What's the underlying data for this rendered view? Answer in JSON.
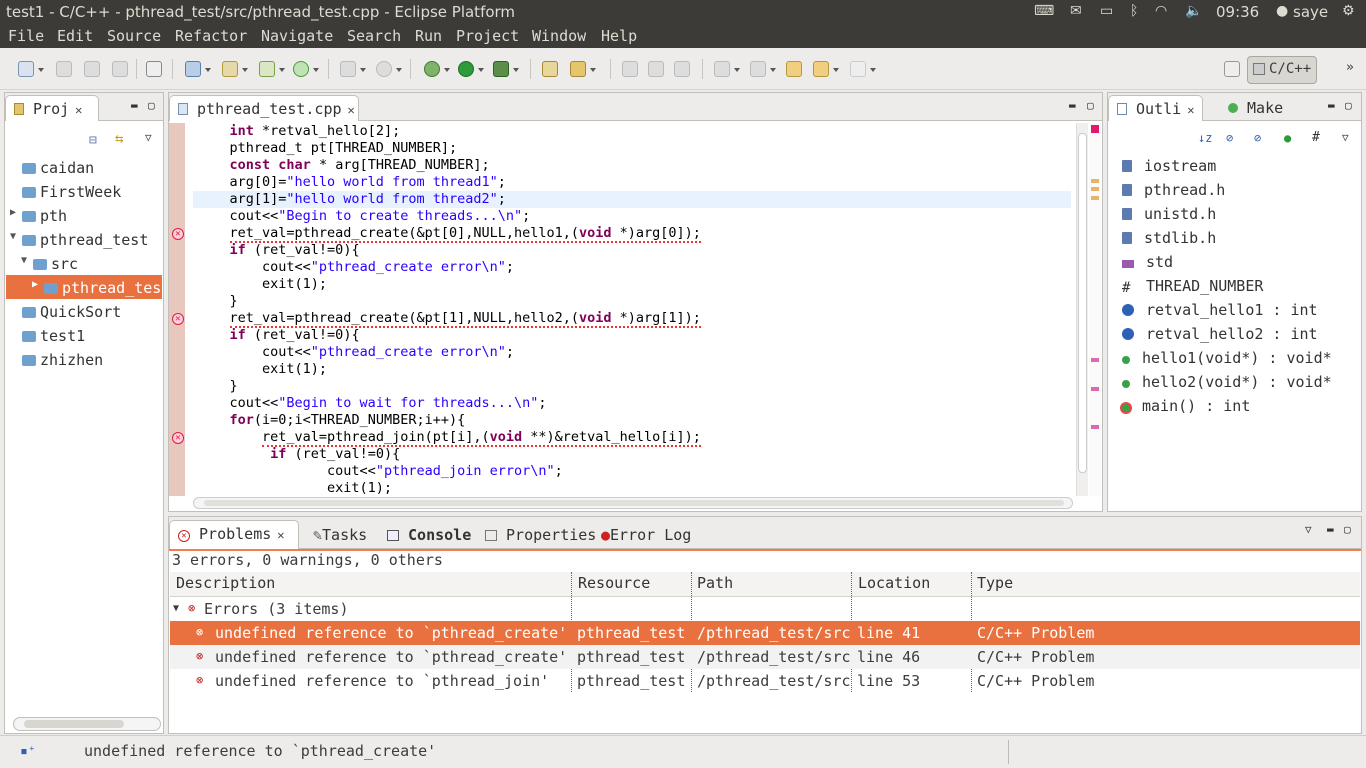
{
  "topbar": {
    "title": "test1 - C/C++ - pthread_test/src/pthread_test.cpp - Eclipse Platform",
    "time": "09:36",
    "user": "saye"
  },
  "menu": [
    "File",
    "Edit",
    "Source",
    "Refactor",
    "Navigate",
    "Search",
    "Run",
    "Project",
    "Window",
    "Help"
  ],
  "perspective": "C/C++",
  "project_explorer": {
    "tab": "Proj",
    "items": [
      {
        "label": "caidan",
        "indent": 0,
        "arrow": ""
      },
      {
        "label": "FirstWeek",
        "indent": 0,
        "arrow": ""
      },
      {
        "label": "pth",
        "indent": 0,
        "arrow": "▶"
      },
      {
        "label": "pthread_test",
        "indent": 0,
        "arrow": "▼"
      },
      {
        "label": "src",
        "indent": 1,
        "arrow": "▼"
      },
      {
        "label": "pthread_tes",
        "indent": 2,
        "arrow": "▶",
        "selected": true
      },
      {
        "label": "QuickSort",
        "indent": 0,
        "arrow": ""
      },
      {
        "label": "test1",
        "indent": 0,
        "arrow": ""
      },
      {
        "label": "zhizhen",
        "indent": 0,
        "arrow": ""
      }
    ]
  },
  "editor": {
    "tab": "pthread_test.cpp",
    "lines": [
      "    int *retval_hello[2];",
      "    pthread_t pt[THREAD_NUMBER];",
      "    const char * arg[THREAD_NUMBER];",
      "    arg[0]=\"hello world from thread1\";",
      "    arg[1]=\"hello world from thread2\";",
      "    cout<<\"Begin to create threads...\\n\";",
      "    ret_val=pthread_create(&pt[0],NULL,hello1,(void *)arg[0]);",
      "    if (ret_val!=0){",
      "        cout<<\"pthread_create error\\n\";",
      "        exit(1);",
      "    }",
      "    ret_val=pthread_create(&pt[1],NULL,hello2,(void *)arg[1]);",
      "    if (ret_val!=0){",
      "        cout<<\"pthread_create error\\n\";",
      "        exit(1);",
      "    }",
      "    cout<<\"Begin to wait for threads...\\n\";",
      "    for(i=0;i<THREAD_NUMBER;i++){",
      "        ret_val=pthread_join(pt[i],(void **)&retval_hello[i]);",
      "         if (ret_val!=0){",
      "                cout<<\"pthread_join error\\n\";",
      "                exit(1);"
    ]
  },
  "outline": {
    "tabs": [
      "Outli",
      "Make"
    ],
    "items": [
      {
        "label": "iostream",
        "kind": "include"
      },
      {
        "label": "pthread.h",
        "kind": "include"
      },
      {
        "label": "unistd.h",
        "kind": "include"
      },
      {
        "label": "stdlib.h",
        "kind": "include"
      },
      {
        "label": "std",
        "kind": "namespace"
      },
      {
        "label": "THREAD_NUMBER",
        "kind": "macro"
      },
      {
        "label": "retval_hello1 : int",
        "kind": "variable"
      },
      {
        "label": "retval_hello2 : int",
        "kind": "variable"
      },
      {
        "label": "hello1(void*) : void*",
        "kind": "function"
      },
      {
        "label": "hello2(void*) : void*",
        "kind": "function"
      },
      {
        "label": "main() : int",
        "kind": "function-error"
      }
    ]
  },
  "bottom": {
    "tabs": [
      "Problems",
      "Tasks",
      "Console",
      "Properties",
      "Error Log"
    ],
    "summary": "3 errors, 0 warnings, 0 others",
    "columns": [
      "Description",
      "Resource",
      "Path",
      "Location",
      "Type"
    ],
    "group": "Errors (3 items)",
    "rows": [
      {
        "description": "undefined reference to `pthread_create'",
        "resource": "pthread_test",
        "path": "/pthread_test/src",
        "location": "line 41",
        "type": "C/C++ Problem",
        "selected": true
      },
      {
        "description": "undefined reference to `pthread_create'",
        "resource": "pthread_test",
        "path": "/pthread_test/src",
        "location": "line 46",
        "type": "C/C++ Problem"
      },
      {
        "description": "undefined reference to `pthread_join'",
        "resource": "pthread_test",
        "path": "/pthread_test/src",
        "location": "line 53",
        "type": "C/C++ Problem"
      }
    ]
  },
  "status": "undefined reference to `pthread_create'",
  "colors": {
    "selection": "#e9713f",
    "keyword": "#7f0055",
    "string": "#2a00ff",
    "error": "#dd2222"
  }
}
